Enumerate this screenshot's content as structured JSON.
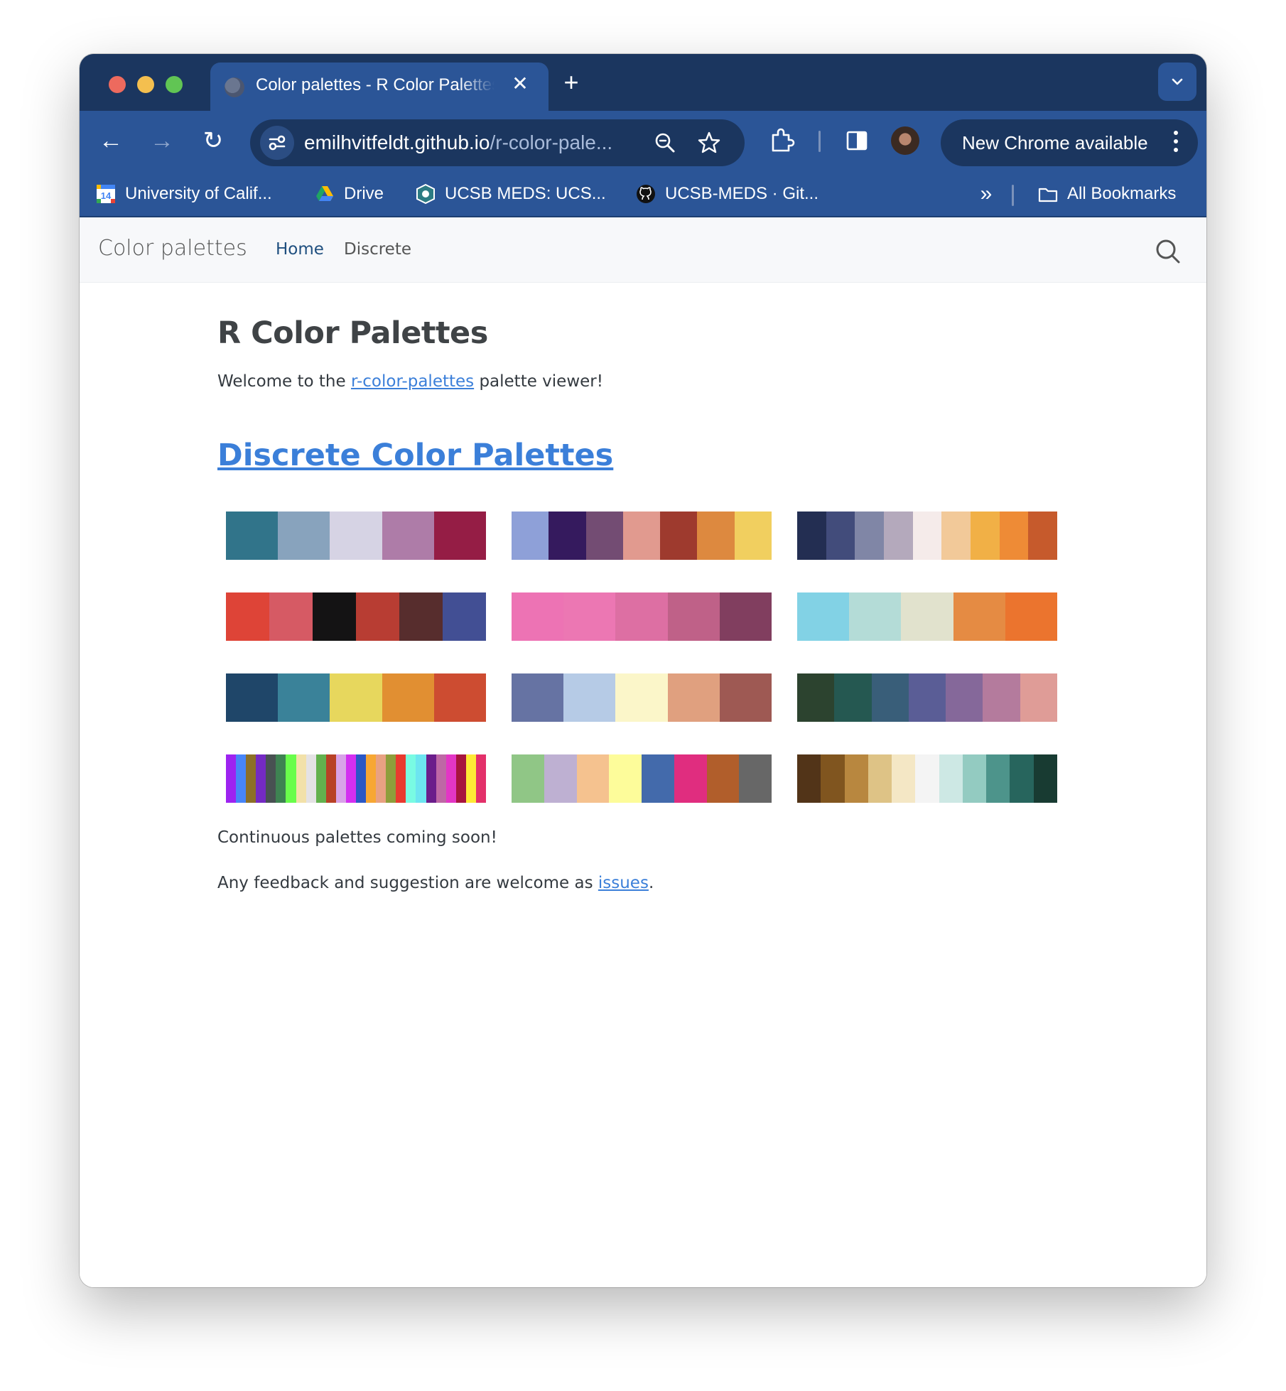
{
  "browser": {
    "tab": {
      "title": "Color palettes - R Color Palettes",
      "close_glyph": "✕"
    },
    "new_tab_glyph": "+",
    "toolbar": {
      "back_glyph": "←",
      "forward_glyph": "→",
      "reload_glyph": "↻",
      "url_host": "emilhvitfeldt.github.io",
      "url_path": "/r-color-pale...",
      "update_label": "New Chrome available"
    },
    "bookmarks": [
      {
        "label": "University of Calif...",
        "icon": "calendar-icon"
      },
      {
        "label": "Drive",
        "icon": "google-drive-icon"
      },
      {
        "label": "UCSB MEDS: UCS...",
        "icon": "meds-shield-icon"
      },
      {
        "label": "UCSB-MEDS · Git...",
        "icon": "github-icon"
      }
    ],
    "bookmarks_more_glyph": "»",
    "all_bookmarks_label": "All Bookmarks"
  },
  "site": {
    "brand": "Color palettes",
    "nav": [
      {
        "label": "Home",
        "active": true
      },
      {
        "label": "Discrete",
        "active": false
      }
    ]
  },
  "content": {
    "title": "R Color Palettes",
    "intro_before": "Welcome to the ",
    "intro_link": "r-color-palettes",
    "intro_after": " palette viewer!",
    "discrete_heading": "Discrete Color Palettes",
    "continuous_note": "Continuous palettes coming soon!",
    "feedback_before": "Any feedback and suggestion are welcome as ",
    "feedback_link": "issues",
    "feedback_after": "."
  },
  "palettes": [
    [
      "#31748a",
      "#88a3bd",
      "#d6d3e4",
      "#ae7ca8",
      "#951d45"
    ],
    [
      "#8ea0d8",
      "#351a5e",
      "#734c73",
      "#e19a8f",
      "#9e3a2e",
      "#dd893f",
      "#f1cf5f"
    ],
    [
      "#232e52",
      "#424c7b",
      "#8086a6",
      "#b4a9bc",
      "#f5ebea",
      "#f2c999",
      "#f1b046",
      "#ee8b36",
      "#c65a2c"
    ],
    [
      "#de4437",
      "#d65a64",
      "#141314",
      "#b83d33",
      "#572d2d",
      "#424f94"
    ],
    [
      "#ed73b4",
      "#ec77b3",
      "#dd6fa3",
      "#bf6188",
      "#813e5f"
    ],
    [
      "#82d2e5",
      "#b4dcd7",
      "#e1e2cd",
      "#e58b43",
      "#eb742e"
    ],
    [
      "#1f4669",
      "#3a8299",
      "#e7d75d",
      "#e18f32",
      "#cd4c31"
    ],
    [
      "#6673a3",
      "#b6cbe6",
      "#fbf6c9",
      "#e0a07f",
      "#9e5953"
    ],
    [
      "#2c432f",
      "#255851",
      "#395e79",
      "#5a5d96",
      "#85689a",
      "#b47b9d",
      "#df9c97"
    ],
    [
      "#9d23f0",
      "#4785f7",
      "#8c6f27",
      "#742ac3",
      "#485152",
      "#3e8352",
      "#69fd4b",
      "#f2e1a9",
      "#e4e2e4",
      "#63b14e",
      "#b84126",
      "#d8a2e8",
      "#d32ff0",
      "#2b58c5",
      "#f7a733",
      "#e8a182",
      "#8e9e3b",
      "#e93a2f",
      "#79fbe3",
      "#6de5f0",
      "#6b1d8b",
      "#be68a5",
      "#e336c5",
      "#a7153e",
      "#fee936",
      "#e3306a"
    ],
    [
      "#90c686",
      "#beb0d2",
      "#f5c28f",
      "#fdfc9a",
      "#436aab",
      "#e02d7f",
      "#b15e2b",
      "#676767"
    ],
    [
      "#523418",
      "#80551f",
      "#b8873f",
      "#dec386",
      "#f4e7c5",
      "#f4f4f4",
      "#cde8e4",
      "#93cbc1",
      "#4d948b",
      "#27655d",
      "#183b32"
    ]
  ]
}
